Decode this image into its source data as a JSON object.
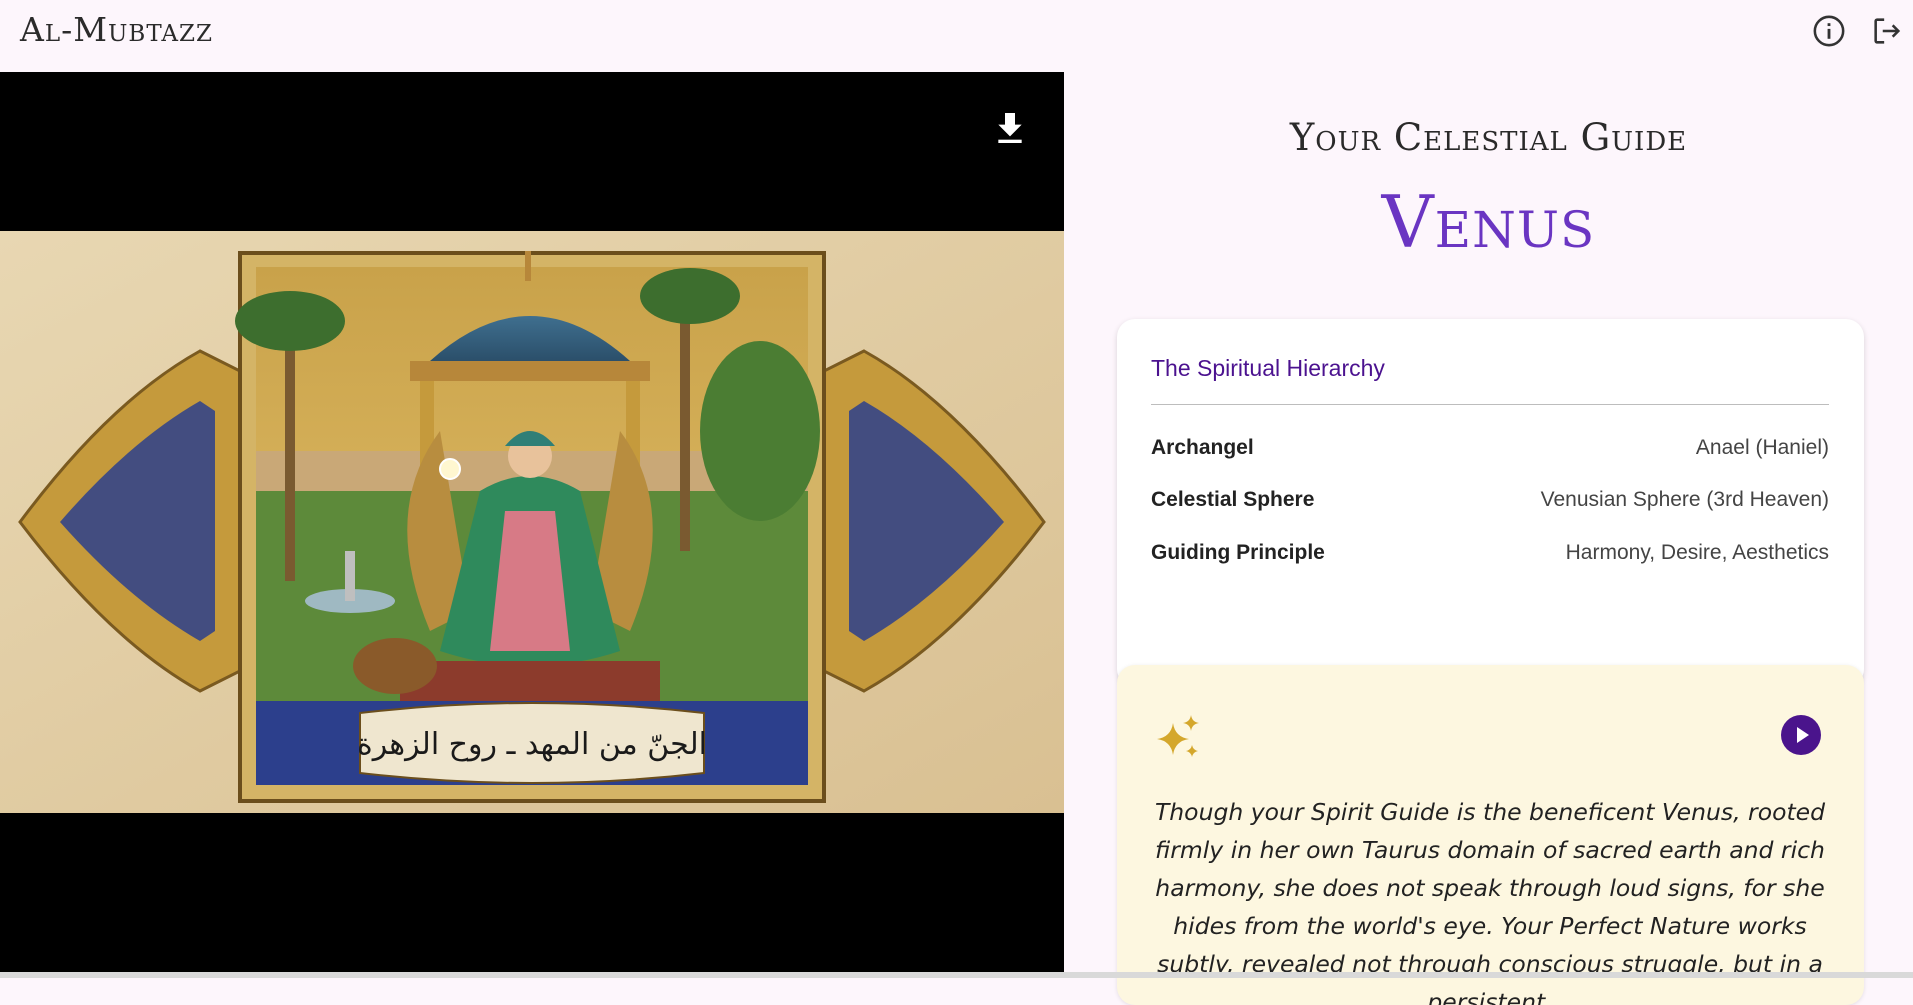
{
  "app": {
    "brand": "Al-Mubtazz"
  },
  "header": {
    "info_icon": "info-circle-icon",
    "logout_icon": "logout-icon"
  },
  "media": {
    "download_icon": "download-icon",
    "artwork_caption": "الجنّ من المهد ـ روح الزهرة"
  },
  "guide": {
    "heading": "Your Celestial Guide",
    "planet": "Venus"
  },
  "hierarchy": {
    "title": "The Spiritual Hierarchy",
    "rows": [
      {
        "label": "Archangel",
        "value": "Anael (Haniel)"
      },
      {
        "label": "Celestial Sphere",
        "value": "Venusian Sphere (3rd Heaven)"
      },
      {
        "label": "Guiding Principle",
        "value": "Harmony, Desire, Aesthetics"
      }
    ]
  },
  "message": {
    "sparkle_icon": "sparkles-icon",
    "play_icon": "play-icon",
    "text": "Though your Spirit Guide is the beneficent Venus, rooted firmly in her own Taurus domain of sacred earth and rich harmony, she does not speak through loud signs, for she hides from the world's eye. Your Perfect Nature works subtly, revealed not through conscious struggle, but in a persistent,"
  },
  "colors": {
    "accent": "#6a35c2",
    "hierarchy_title": "#4b128f",
    "play_button": "#4a148c",
    "sparkle": "#d4a72c",
    "page_bg": "#fdf6fc",
    "message_bg": "#fdf7e0"
  }
}
